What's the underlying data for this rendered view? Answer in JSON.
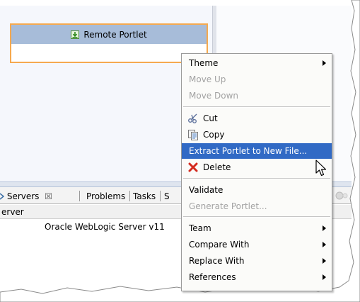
{
  "editor": {
    "portlet_title": "Remote Portlet"
  },
  "views": {
    "tabs": [
      {
        "label": "Servers",
        "close": "☒"
      },
      {
        "label": "Problems"
      },
      {
        "label": "Tasks"
      },
      {
        "label": "S"
      }
    ],
    "column_header": "erver",
    "row_value": "Oracle WebLogic Server v11"
  },
  "context_menu": {
    "items": [
      {
        "label": "Theme",
        "submenu": true
      },
      {
        "label": "Move Up",
        "disabled": true
      },
      {
        "label": "Move Down",
        "disabled": true
      },
      {
        "label": "Cut",
        "icon": "scissors-icon"
      },
      {
        "label": "Copy",
        "icon": "copy-icon"
      },
      {
        "label": "Extract Portlet to New File...",
        "highlighted": true
      },
      {
        "label": "Delete",
        "icon": "delete-x-icon"
      },
      {
        "label": "Validate"
      },
      {
        "label": "Generate Portlet...",
        "disabled": true
      },
      {
        "label": "Team",
        "submenu": true
      },
      {
        "label": "Compare With",
        "submenu": true
      },
      {
        "label": "Replace With",
        "submenu": true
      },
      {
        "label": "References",
        "submenu": true
      }
    ]
  },
  "colors": {
    "highlight": "#316ac5",
    "portlet_border": "#f5a94f",
    "portlet_header": "#a7bcd9"
  }
}
